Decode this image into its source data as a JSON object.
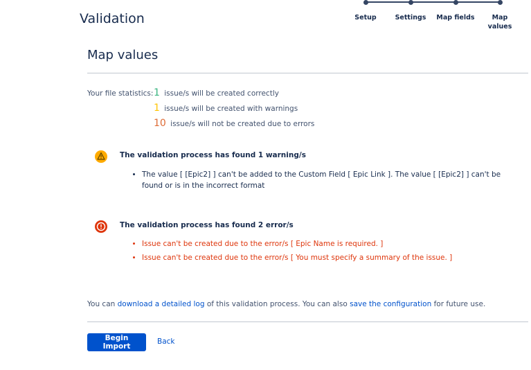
{
  "page": {
    "title": "Validation"
  },
  "wizard": {
    "steps": [
      {
        "label": "Setup"
      },
      {
        "label": "Settings"
      },
      {
        "label": "Map fields"
      },
      {
        "label": "Map values"
      }
    ]
  },
  "section": {
    "title": "Map values"
  },
  "stats": {
    "label": "Your file statistics:",
    "rows": [
      {
        "count": "1",
        "text": "issue/s will be created correctly",
        "color": "#36b37e"
      },
      {
        "count": "1",
        "text": "issue/s will be created with warnings",
        "color": "#ffc400"
      },
      {
        "count": "10",
        "text": "issue/s will not be created due to errors",
        "color": "#de6b35"
      }
    ]
  },
  "warnings": {
    "title": "The validation process has found 1 warning/s",
    "icon": "warning-icon",
    "items": [
      "The value [ [Epic2] ] can't be added to the Custom Field [ Epic Link ]. The value [ [Epic2] ] can't be found or is in the incorrect format"
    ]
  },
  "errors": {
    "title": "The validation process has found 2 error/s",
    "icon": "error-icon",
    "items": [
      "Issue can't be created due to the error/s [ Epic Name is required. ]",
      "Issue can't be created due to the error/s [ You must specify a summary of the issue. ]"
    ]
  },
  "footer": {
    "text1": "You can ",
    "link1": "download a detailed log",
    "text2": " of this validation process. You can also ",
    "link2": "save the configuration",
    "text3": " for future use."
  },
  "actions": {
    "begin_import": "Begin Import",
    "back": "Back"
  },
  "colors": {
    "primary": "#0052cc",
    "error": "#de350b",
    "warning": "#ffab00",
    "success": "#36b37e"
  }
}
